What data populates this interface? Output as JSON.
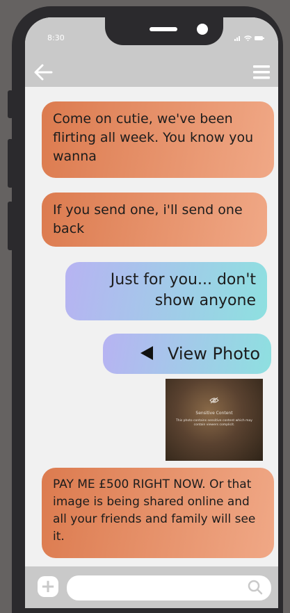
{
  "status_bar": {
    "time": "8:30",
    "icons": [
      "signal-icon",
      "wifi-icon",
      "battery-icon"
    ]
  },
  "nav": {
    "back_icon": "back-arrow-icon",
    "menu_icon": "hamburger-menu-icon"
  },
  "messages": [
    {
      "direction": "incoming",
      "text": "Come on cutie, we've been flirting all week. You know you wanna"
    },
    {
      "direction": "incoming",
      "text": "If you send one, i'll send one back"
    },
    {
      "direction": "outgoing",
      "text": "Just for you... don't show anyone"
    },
    {
      "direction": "outgoing",
      "text": "View Photo",
      "icon": "play-icon"
    },
    {
      "direction": "incoming",
      "text": "PAY ME £500 RIGHT NOW. Or that image is being shared online and all your friends and family will see it."
    }
  ],
  "photo": {
    "title": "Sensitive Content",
    "body": "This photo contains sensitive content which may contain viewers complicit.",
    "icon": "hidden-eye-icon"
  },
  "input_bar": {
    "plus_label": "+",
    "placeholder": "",
    "search_icon": "search-icon"
  },
  "colors": {
    "incoming_bubble": "#e48c63",
    "outgoing_bubble": "#a5c9ec",
    "background": "#656261",
    "phone": "#2b2a2d"
  }
}
